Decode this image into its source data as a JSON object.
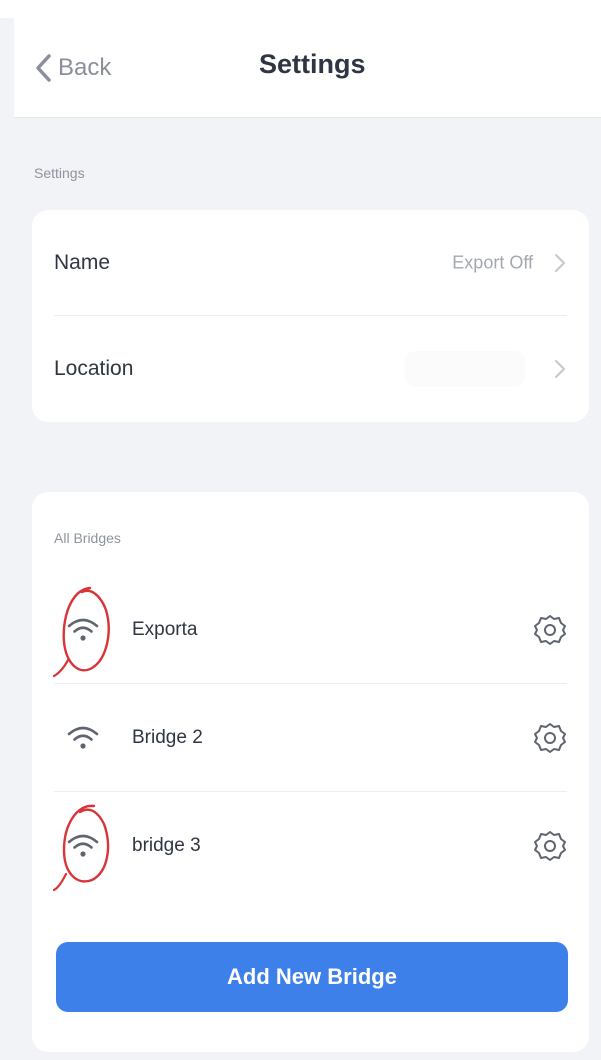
{
  "header": {
    "back_label": "Back",
    "title": "Settings"
  },
  "settings_section": {
    "label": "Settings",
    "rows": [
      {
        "label": "Name",
        "value": "Export Off"
      },
      {
        "label": "Location",
        "value": ""
      }
    ]
  },
  "bridges_section": {
    "label": "All Bridges",
    "bridges": [
      {
        "name": "Exporta",
        "signal_icon": "wifi-icon",
        "annotated": true
      },
      {
        "name": "Bridge 2",
        "signal_icon": "wifi-icon",
        "annotated": false
      },
      {
        "name": "bridge 3",
        "signal_icon": "wifi-icon",
        "annotated": true
      }
    ],
    "add_button_label": "Add New Bridge"
  },
  "colors": {
    "accent": "#3d80ea",
    "background": "#f2f3f7",
    "annotation": "#d8343a",
    "text_primary": "#2f3542",
    "text_secondary": "#a3a8b0"
  }
}
